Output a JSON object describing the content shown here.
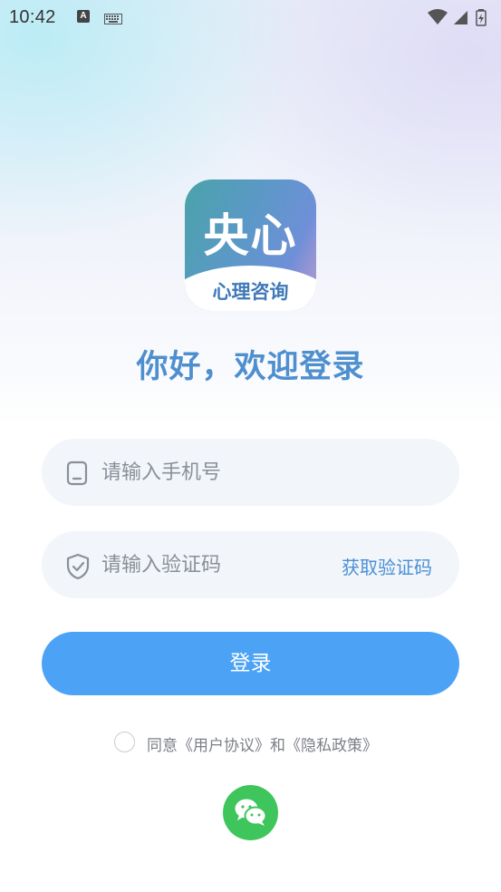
{
  "status_bar": {
    "time": "10:42",
    "notification_letter": "A",
    "keyboard_icon": "keyboard-icon",
    "wifi_icon": "wifi-icon",
    "signal_icon": "signal-icon",
    "battery_icon": "battery-icon"
  },
  "logo": {
    "main_text": "央心",
    "sub_text": "心理咨询"
  },
  "welcome_title": "你好，欢迎登录",
  "phone_field": {
    "placeholder": "请输入手机号",
    "value": "",
    "icon": "phone-icon"
  },
  "code_field": {
    "placeholder": "请输入验证码",
    "value": "",
    "icon": "shield-check-icon",
    "get_code_label": "获取验证码"
  },
  "login_button": "登录",
  "agreement": {
    "checked": false,
    "text": "同意《用户协议》和《隐私政策》"
  },
  "wechat_login": {
    "icon": "wechat-icon"
  },
  "colors": {
    "accent": "#4ca3f5",
    "title": "#4e8fce",
    "link": "#4a90d6",
    "wechat": "#3ec55b",
    "field_bg": "#f2f5f9"
  }
}
